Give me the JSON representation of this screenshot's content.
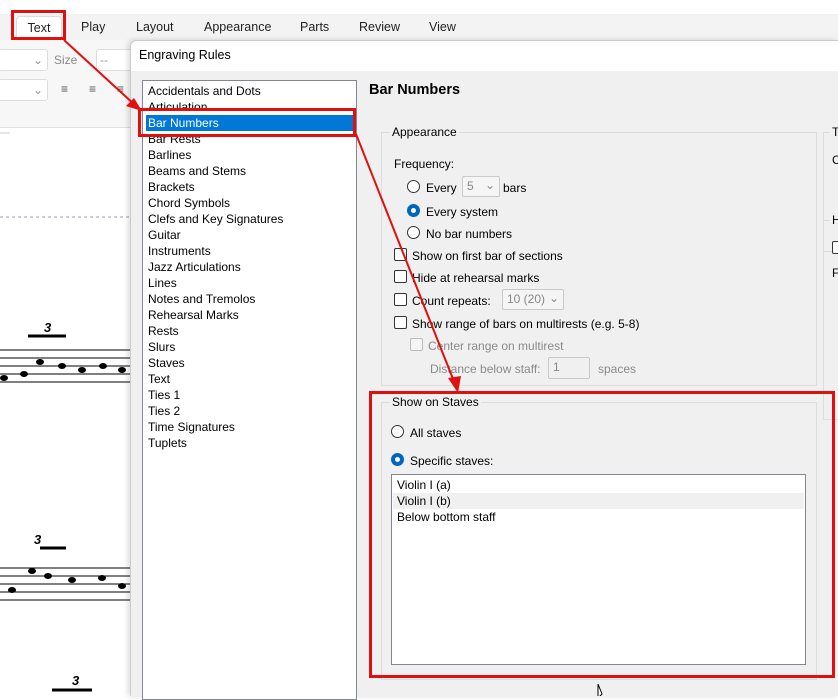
{
  "tabs": [
    {
      "label": "Text",
      "active": true
    },
    {
      "label": "Play"
    },
    {
      "label": "Layout"
    },
    {
      "label": "Appearance"
    },
    {
      "label": "Parts"
    },
    {
      "label": "Review"
    },
    {
      "label": "View"
    }
  ],
  "ribbon": {
    "size_label": "Size",
    "size_value": "--"
  },
  "score": {
    "tuplet_label": "3"
  },
  "dialog": {
    "title": "Engraving Rules",
    "categories": [
      "Accidentals and Dots",
      "Articulation",
      "Bar Numbers",
      "Bar Rests",
      "Barlines",
      "Beams and Stems",
      "Brackets",
      "Chord Symbols",
      "Clefs and Key Signatures",
      "Guitar",
      "Instruments",
      "Jazz Articulations",
      "Lines",
      "Notes and Tremolos",
      "Rehearsal Marks",
      "Rests",
      "Slurs",
      "Staves",
      "Text",
      "Ties 1",
      "Ties 2",
      "Time Signatures",
      "Tuplets"
    ],
    "selected_category": "Bar Numbers",
    "heading": "Bar Numbers",
    "appearance": {
      "label": "Appearance",
      "frequency_label": "Frequency:",
      "every_label": "Every",
      "every_value": "5",
      "bars_label": "bars",
      "every_system_label": "Every system",
      "no_bar_numbers_label": "No bar numbers",
      "frequency_selected": "Every system",
      "show_first_bar": "Show on first bar of sections",
      "hide_rehearsal": "Hide at rehearsal marks",
      "count_repeats": "Count repeats:",
      "count_repeats_value": "10 (20)",
      "show_range": "Show range of bars on multirests (e.g. 5-8)",
      "center_range": "Center range on multirest",
      "distance_label": "Distance below staff:",
      "distance_value": "1",
      "spaces_label": "spaces"
    },
    "show_on_staves": {
      "label": "Show on Staves",
      "all_staves": "All staves",
      "specific_staves": "Specific staves:",
      "selected": "Specific staves",
      "staves": [
        "Violin I (a)",
        "Violin I (b)",
        "Below bottom staff"
      ]
    },
    "right_partial": {
      "group1": "Te",
      "c": "C",
      "group2": "H",
      "f": "Fi"
    }
  },
  "colors": {
    "accent": "#0078d7",
    "annotation": "#e01010"
  }
}
